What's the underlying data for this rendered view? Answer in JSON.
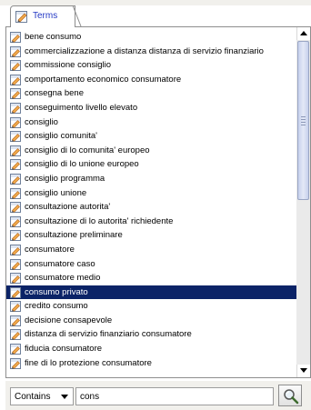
{
  "tabs": [
    {
      "label": "Terms",
      "icon": "term-icon"
    }
  ],
  "terms": {
    "icon": "term-icon",
    "selected_index": 18,
    "items": [
      "bene consumo",
      "commercializzazione a distanza distanza di servizio finanziario",
      "commissione consiglio",
      "comportamento economico consumatore",
      "consegna bene",
      "conseguimento livello elevato",
      "consiglio",
      "consiglio comunita'",
      "consiglio di lo comunita' europeo",
      "consiglio di lo unione europeo",
      "consiglio programma",
      "consiglio unione",
      "consultazione autorita'",
      "consultazione di lo autorita' richiedente",
      "consultazione preliminare",
      "consumatore",
      "consumatore caso",
      "consumatore medio",
      "consumo privato",
      "credito consumo",
      "decisione consapevole",
      "distanza di servizio finanziario consumatore",
      "fiducia consumatore",
      "fine di lo protezione consumatore"
    ]
  },
  "filter": {
    "match_mode": "Contains",
    "query": "cons"
  },
  "colors": {
    "selection": "#0b2367",
    "tab_text": "#2338c4"
  }
}
